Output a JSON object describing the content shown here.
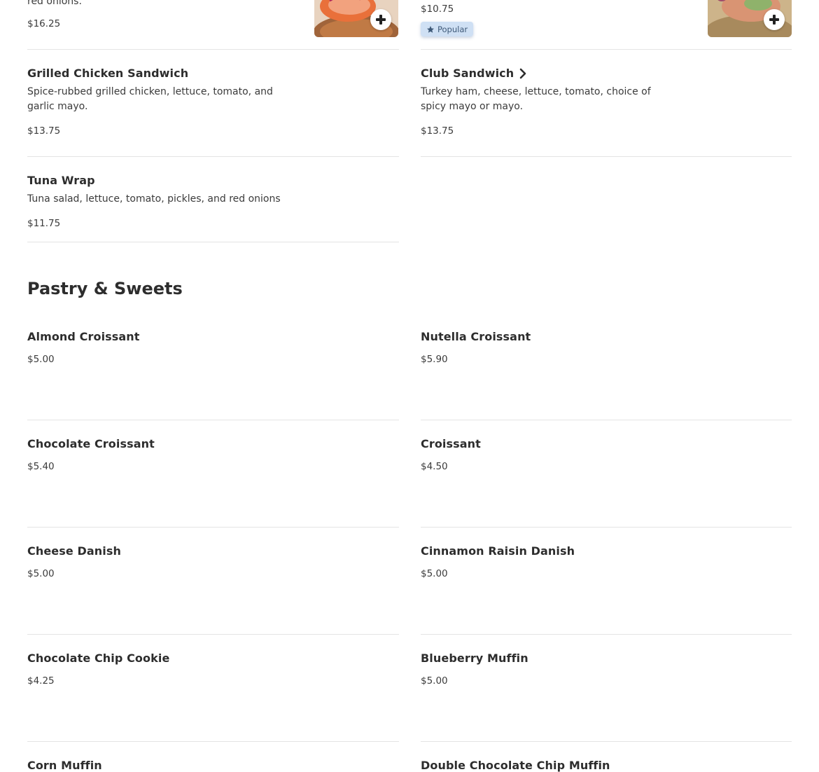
{
  "sandwiches": {
    "partial_left": {
      "desc_tail": "red onions.",
      "price": "$16.25"
    },
    "partial_right": {
      "price": "$10.75",
      "badge": "Popular"
    },
    "items": [
      {
        "name": "Grilled Chicken Sandwich",
        "desc": "Spice-rubbed grilled chicken, lettuce, tomato, and garlic mayo.",
        "price": "$13.75"
      },
      {
        "name": "Club Sandwich",
        "desc": "Turkey ham, cheese, lettuce, tomato, choice of spicy mayo or mayo.",
        "price": "$13.75"
      },
      {
        "name": "Tuna Wrap",
        "desc": "Tuna salad, lettuce, tomato, pickles, and red onions",
        "price": "$11.75"
      }
    ]
  },
  "pastry": {
    "title": "Pastry & Sweets",
    "items": [
      {
        "name": "Almond Croissant",
        "price": "$5.00"
      },
      {
        "name": "Nutella Croissant",
        "price": "$5.90"
      },
      {
        "name": "Chocolate Croissant",
        "price": "$5.40"
      },
      {
        "name": "Croissant",
        "price": "$4.50"
      },
      {
        "name": "Cheese Danish",
        "price": "$5.00"
      },
      {
        "name": "Cinnamon Raisin Danish",
        "price": "$5.00"
      },
      {
        "name": "Chocolate Chip Cookie",
        "price": "$4.25"
      },
      {
        "name": "Blueberry Muffin",
        "price": "$5.00"
      },
      {
        "name": "Corn Muffin"
      },
      {
        "name": "Double Chocolate Chip Muffin"
      }
    ]
  },
  "icons": {
    "add": "plus-icon",
    "popular": "star-icon",
    "more": "chevron-right-icon"
  },
  "colors": {
    "badge_bg": "#cfe0f4",
    "badge_text": "#3f5a79",
    "divider": "#e4e4e4"
  }
}
